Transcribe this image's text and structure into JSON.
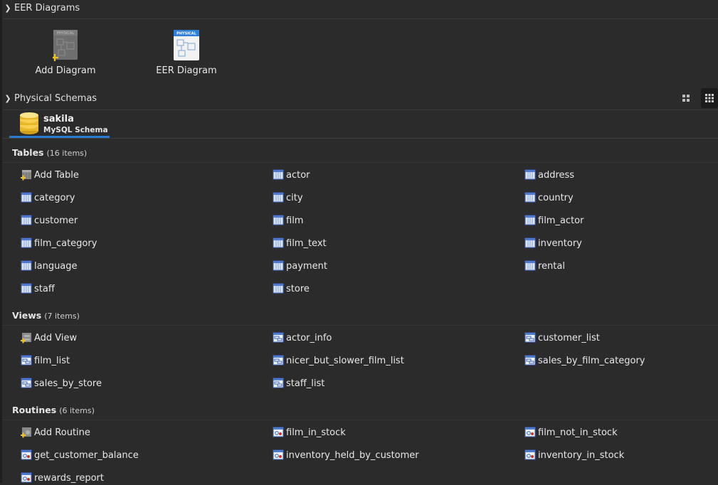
{
  "eer": {
    "header": "EER Diagrams",
    "tiles": [
      {
        "label": "Add Diagram",
        "thumb_text": "PHYSICAL"
      },
      {
        "label": "EER Diagram",
        "thumb_text": "PHYSICAL"
      }
    ]
  },
  "schemas": {
    "header": "Physical Schemas",
    "tab": {
      "name": "sakila",
      "subtitle": "MySQL Schema"
    }
  },
  "tables": {
    "title": "Tables",
    "count": "(16 items)",
    "items": [
      "Add Table",
      "actor",
      "address",
      "category",
      "city",
      "country",
      "customer",
      "film",
      "film_actor",
      "film_category",
      "film_text",
      "inventory",
      "language",
      "payment",
      "rental",
      "staff",
      "store"
    ]
  },
  "views": {
    "title": "Views",
    "count": "(7 items)",
    "items": [
      "Add View",
      "actor_info",
      "customer_list",
      "film_list",
      "nicer_but_slower_film_list",
      "sales_by_film_category",
      "sales_by_store",
      "staff_list"
    ]
  },
  "routines": {
    "title": "Routines",
    "count": "(6 items)",
    "items": [
      "Add Routine",
      "film_in_stock",
      "film_not_in_stock",
      "get_customer_balance",
      "inventory_held_by_customer",
      "inventory_in_stock",
      "rewards_report"
    ]
  },
  "colors": {
    "accent": "#2a7cd3",
    "background": "#2b2b2b"
  }
}
